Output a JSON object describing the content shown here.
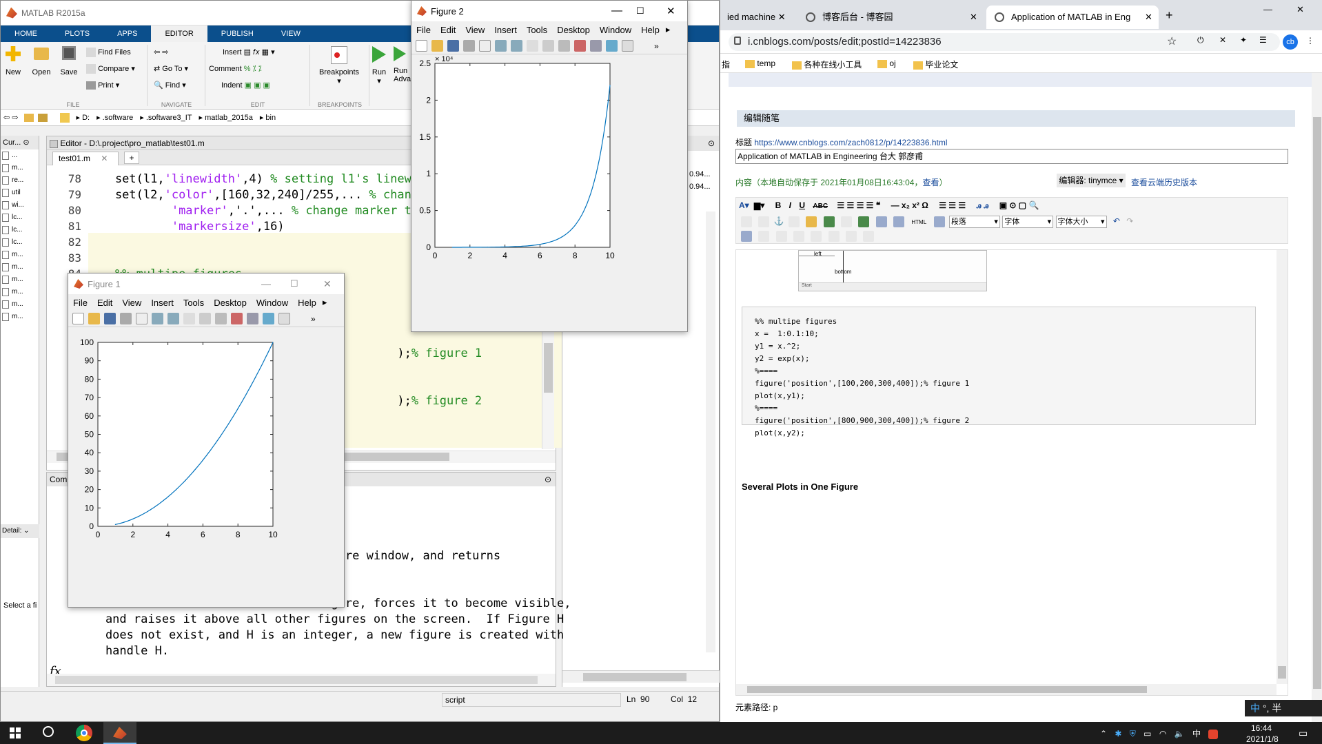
{
  "matlab": {
    "title": "MATLAB R2015a",
    "tabs": [
      "HOME",
      "PLOTS",
      "APPS",
      "EDITOR",
      "PUBLISH",
      "VIEW"
    ],
    "active_tab": "EDITOR",
    "ribbon": {
      "new": "New",
      "open": "Open",
      "save": "Save",
      "find_files": "Find Files",
      "compare": "Compare",
      "print": "Print",
      "go_to": "Go To",
      "find": "Find",
      "insert": "Insert",
      "comment": "Comment",
      "indent": "Indent",
      "breakpoints": "Breakpoints",
      "run": "Run",
      "run_advance": "Run Adva",
      "group_file": "FILE",
      "group_navigate": "NAVIGATE",
      "group_edit": "EDIT",
      "group_breakpoints": "BREAKPOINTS"
    },
    "path": [
      "D:",
      ".software",
      ".software3_IT",
      "matlab_2015a",
      "bin"
    ],
    "current_folder_label": "Cur...",
    "folder_items": [
      "...",
      "m...",
      "re...",
      "util",
      "wi...",
      "lc...",
      "lc...",
      "lc...",
      "m...",
      "m...",
      "m...",
      "m...",
      "m...",
      "m..."
    ],
    "details_label": "Detail:",
    "select_label": "Select a fi",
    "editor_title": "Editor - D:\\.project\\pro_matlab\\test01.m",
    "editor_tab": "test01.m",
    "code": [
      {
        "n": "78",
        "parts": [
          [
            "kw",
            "    set(l1,"
          ],
          [
            "str",
            "'linewidth'"
          ],
          [
            "kw",
            ",4) "
          ],
          [
            "cmt",
            "% setting l1's linewidt"
          ]
        ]
      },
      {
        "n": "79",
        "parts": [
          [
            "kw",
            "    set(l2,"
          ],
          [
            "str",
            "'color'"
          ],
          [
            "kw",
            ",[160,32,240]/255,... "
          ],
          [
            "cmt",
            "% change"
          ]
        ]
      },
      {
        "n": "80",
        "parts": [
          [
            "kw",
            "            "
          ],
          [
            "str",
            "'marker'"
          ],
          [
            "kw",
            ",'.',... "
          ],
          [
            "cmt",
            "% change marker to po"
          ]
        ]
      },
      {
        "n": "81",
        "parts": [
          [
            "kw",
            "            "
          ],
          [
            "str",
            "'markersize'"
          ],
          [
            "kw",
            ",16)"
          ]
        ]
      },
      {
        "n": "82",
        "parts": []
      },
      {
        "n": "83",
        "parts": []
      },
      {
        "n": "84",
        "parts": [
          [
            "cmt",
            "    %% multipe figures"
          ]
        ]
      },
      {
        "n": "85",
        "parts": []
      },
      {
        "n": "86",
        "parts": []
      },
      {
        "n": "87",
        "parts": []
      },
      {
        "n": "88",
        "parts": []
      },
      {
        "n": "89",
        "parts": [
          [
            "kw",
            "                                            );"
          ],
          [
            "cmt",
            "% figure 1"
          ]
        ]
      },
      {
        "n": "90",
        "parts": []
      },
      {
        "n": "91",
        "parts": []
      },
      {
        "n": "92",
        "parts": [
          [
            "kw",
            "                                            );"
          ],
          [
            "cmt",
            "% figure 2"
          ]
        ]
      },
      {
        "n": "93",
        "parts": []
      },
      {
        "n": "94",
        "parts": []
      },
      {
        "n": "95",
        "parts": []
      }
    ],
    "workspace_values": [
      "0.94...",
      "0.94..."
    ],
    "command_label": "Com",
    "help_lines": [
      "                                     ure window, and returns",
      "",
      "",
      "                      the current figure, forces it to become visible,",
      "    and raises it above all other figures on the screen.  If Figure H",
      "    does not exist, and H is an integer, a new figure is created with",
      "    handle H."
    ],
    "fx": "fx",
    "status": {
      "mode": "script",
      "ln_label": "Ln",
      "ln": "90",
      "col_label": "Col",
      "col": "12"
    }
  },
  "figure1": {
    "title": "Figure 1",
    "menu": [
      "File",
      "Edit",
      "View",
      "Insert",
      "Tools",
      "Desktop",
      "Window",
      "Help"
    ]
  },
  "figure2": {
    "title": "Figure 2",
    "menu": [
      "File",
      "Edit",
      "View",
      "Insert",
      "Tools",
      "Desktop",
      "Window",
      "Help"
    ],
    "exponent": "× 10⁴"
  },
  "chart_data": [
    {
      "type": "line",
      "x_function": "x = 1:0.1:10",
      "y_function": "y1 = x.^2",
      "x": [
        1,
        2,
        3,
        4,
        5,
        6,
        7,
        8,
        9,
        10
      ],
      "y": [
        1,
        4,
        9,
        16,
        25,
        36,
        49,
        64,
        81,
        100
      ],
      "xlim": [
        0,
        10
      ],
      "ylim": [
        0,
        100
      ],
      "xticks": [
        "0",
        "2",
        "4",
        "6",
        "8",
        "10"
      ],
      "yticks": [
        "0",
        "10",
        "20",
        "30",
        "40",
        "50",
        "60",
        "70",
        "80",
        "90",
        "100"
      ],
      "color": "#0072bd",
      "grid": false
    },
    {
      "type": "line",
      "x_function": "x = 1:0.1:10",
      "y_function": "y2 = exp(x)",
      "x": [
        1,
        2,
        3,
        4,
        5,
        6,
        7,
        8,
        9,
        10
      ],
      "y": [
        2.718,
        7.389,
        20.09,
        54.6,
        148.4,
        403.4,
        1096.6,
        2981,
        8103,
        22026
      ],
      "xlim": [
        0,
        10
      ],
      "ylim": [
        0,
        25000
      ],
      "xticks": [
        "0",
        "2",
        "4",
        "6",
        "8",
        "10"
      ],
      "yticks": [
        "0",
        "0.5",
        "1",
        "1.5",
        "2",
        "2.5"
      ],
      "color": "#0072bd",
      "grid": false
    }
  ],
  "browser": {
    "tabs": [
      "ied machine",
      "博客后台 - 博客园",
      "Application of MATLAB in Eng"
    ],
    "url": "i.cnblogs.com/posts/edit;postId=14223836",
    "bookmarks": [
      "temp",
      "各种在线小工具",
      "oj",
      "毕业论文"
    ],
    "bookmark_left": "指",
    "section_title": "编辑随笔",
    "title_label": "标题",
    "post_link": "https://www.cnblogs.com/zach0812/p/14223836.html",
    "title_value": "Application of MATLAB in Engineering 台大 郭彦甫",
    "content_label": "内容",
    "autosave": "（本地自动保存于 2021年01月08日16:43:04，",
    "autosave_view": "查看",
    "autosave_end": "）",
    "editor_select": "编辑器: tinymce",
    "history_link": "查看云端历史版本",
    "format_select": "段落",
    "font_select": "字体",
    "size_select": "字体大小",
    "img_labels": {
      "left": "left",
      "bottom": "bottom",
      "start": "Start"
    },
    "code_block": [
      "%% multipe figures",
      "x =  1:0.1:10;",
      "y1 = x.^2;",
      "y2 = exp(x);",
      "%====",
      "figure('position',[100,200,300,400]);% figure 1",
      "plot(x,y1);",
      "%====",
      "figure('position',[800,900,300,400]);% figure 2",
      "plot(x,y2);"
    ],
    "heading": "Several Plots in One Figure",
    "element_path": "元素路径: p"
  },
  "taskbar": {
    "time": "16:44",
    "date": "2021/1/8",
    "ime": "中",
    "ime_extra": "°, 半"
  },
  "colors": {
    "matlab_blue": "#0b4f8c",
    "plot_line": "#0072bd",
    "chrome_accent": "#1a73e8"
  }
}
